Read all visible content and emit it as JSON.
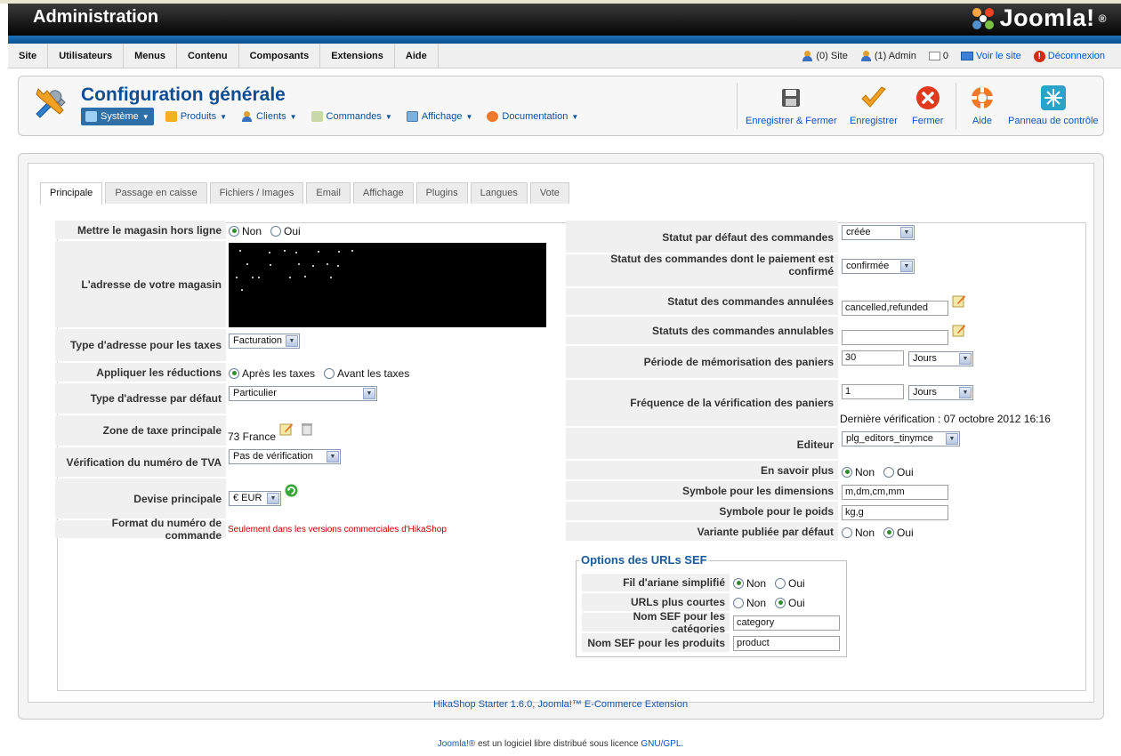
{
  "header": {
    "title": "Administration",
    "logo_text": "Joomla!",
    "logo_mark": "®"
  },
  "menubar": {
    "menus": [
      "Site",
      "Utilisateurs",
      "Menus",
      "Contenu",
      "Composants",
      "Extensions",
      "Aide"
    ],
    "status": {
      "site_users": "(0) Site",
      "admin_users": "(1) Admin",
      "messages": "0",
      "view_site": "Voir le site",
      "logout": "Déconnexion"
    }
  },
  "toolbar": {
    "page_title": "Configuration générale",
    "submenu": {
      "systeme": "Système",
      "produits": "Produits",
      "clients": "Clients",
      "commandes": "Commandes",
      "affichage": "Affichage",
      "documentation": "Documentation"
    },
    "buttons": {
      "save_close": "Enregistrer & Fermer",
      "save": "Enregistrer",
      "close": "Fermer",
      "help": "Aide",
      "control_panel": "Panneau de contrôle"
    }
  },
  "tabs": [
    "Principale",
    "Passage en caisse",
    "Fichiers / Images",
    "Email",
    "Affichage",
    "Plugins",
    "Langues",
    "Vote"
  ],
  "left": {
    "offline_label": "Mettre le magasin hors ligne",
    "offline_no": "Non",
    "offline_yes": "Oui",
    "address_label": "L'adresse de votre magasin",
    "tax_address_label": "Type d'adresse pour les taxes",
    "tax_address_value": "Facturation",
    "discount_label": "Appliquer les réductions",
    "discount_after": "Après les taxes",
    "discount_before": "Avant les taxes",
    "default_address_label": "Type d'adresse par défaut",
    "default_address_value": "Particulier",
    "tax_zone_label": "Zone de taxe principale",
    "tax_zone_value": "73 France",
    "vat_label": "Vérification du numéro de TVA",
    "vat_value": "Pas de vérification",
    "currency_label": "Devise principale",
    "currency_value": "€ EUR",
    "order_format_label": "Format du numéro de commande",
    "order_format_note": "Seulement dans les versions commerciales d'HikaShop"
  },
  "right": {
    "default_status_label": "Statut par défaut des commandes",
    "default_status_value": "créée",
    "confirmed_status_label": "Statut des commandes dont le paiement est confirmé",
    "confirmed_status_value": "confirmée",
    "cancelled_label": "Statut des commandes annulées",
    "cancelled_value": "cancelled,refunded",
    "cancellable_label": "Statuts des commandes annulables",
    "cancellable_value": "",
    "cart_period_label": "Période de mémorisation des paniers",
    "cart_period_value": "30",
    "cart_period_unit": "Jours",
    "cart_check_label": "Fréquence de la vérification des paniers",
    "cart_check_value": "1",
    "cart_check_unit": "Jours",
    "last_check": "Dernière vérification : 07 octobre 2012 16:16",
    "editor_label": "Editeur",
    "editor_value": "plg_editors_tinymce",
    "more_label": "En savoir plus",
    "more_no": "Non",
    "more_yes": "Oui",
    "dimension_label": "Symbole pour les dimensions",
    "dimension_value": "m,dm,cm,mm",
    "weight_label": "Symbole pour le poids",
    "weight_value": "kg,g",
    "variant_label": "Variante publiée par défaut",
    "variant_no": "Non",
    "variant_yes": "Oui"
  },
  "sef": {
    "legend": "Options des URLs SEF",
    "breadcrumb_label": "Fil d'ariane simplifié",
    "breadcrumb_no": "Non",
    "breadcrumb_yes": "Oui",
    "short_label": "URLs plus courtes",
    "short_no": "Non",
    "short_yes": "Oui",
    "cat_label": "Nom SEF pour les catégories",
    "cat_value": "category",
    "prod_label": "Nom SEF pour les produits",
    "prod_value": "product"
  },
  "footer": {
    "extension": "HikaShop Starter 1.6.0, Joomla!™ E-Commerce Extension",
    "joomla_link": "Joomla!®",
    "license_text": " est un logiciel libre distribué sous licence ",
    "gpl_link": "GNU/GPL",
    "end": "."
  },
  "colors": {
    "accent": "#0f4d92",
    "link": "#0b55c4",
    "header_blue": "#1f72b8",
    "radio_on": "#2e8b2e"
  }
}
